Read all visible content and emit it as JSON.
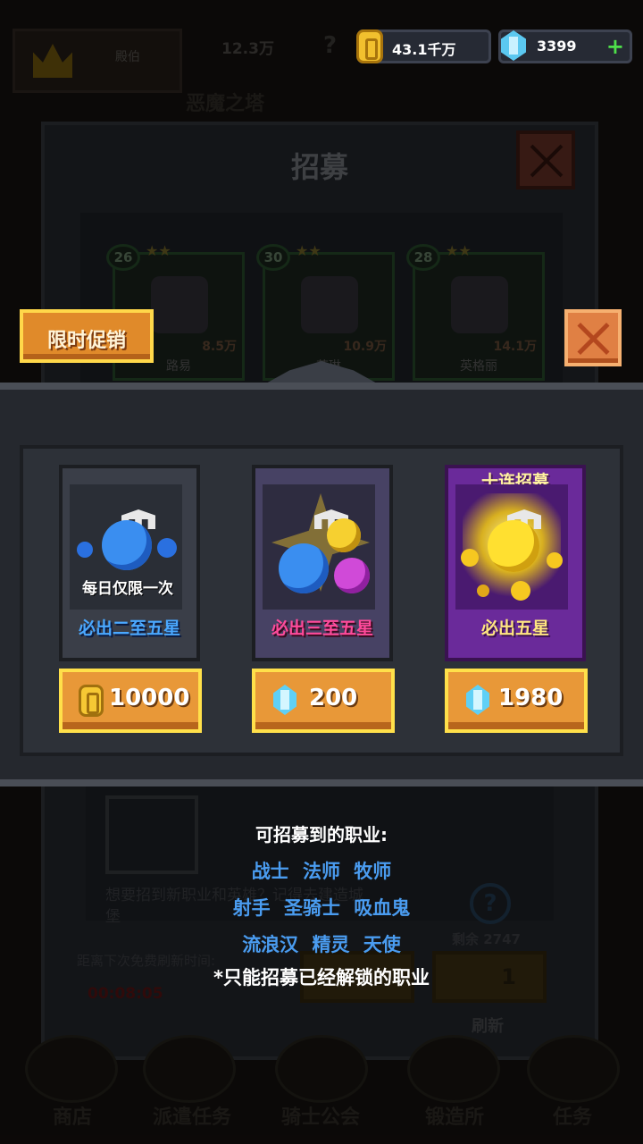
{
  "topbar": {
    "player_name": "殿伯",
    "power": "12.3万",
    "help": "?",
    "gold": "43.1千万",
    "gems": "3399",
    "add": "+"
  },
  "background": {
    "tower_title": "恶魔之塔",
    "dialog_title": "招募",
    "heroes": [
      {
        "level": "26",
        "stars": "★★",
        "power": "8.5万",
        "name": "路易"
      },
      {
        "level": "30",
        "stars": "★★",
        "power": "10.9万",
        "name": "艾琳"
      },
      {
        "level": "28",
        "stars": "★★",
        "power": "14.1万",
        "name": "英格丽"
      }
    ],
    "hint": "想要招到新职业和英雄？记得去建造城堡",
    "remaining": "剩余 2747",
    "refresh_countdown_label": "距离下次免费刷新时间:",
    "refresh_timer": "00:08:05",
    "refresh_cost": "1",
    "refresh_label": "刷新",
    "nav": [
      "商店",
      "派遣任务",
      "骑士公会",
      "锻造所",
      "任务"
    ]
  },
  "promo": {
    "tag": "限时促销",
    "offers": [
      {
        "note": "每日仅限一次",
        "subtitle": "必出二至五星",
        "price": "10000",
        "currency": "gold"
      },
      {
        "subtitle": "必出三至五星",
        "price": "200",
        "currency": "gem"
      },
      {
        "badge": "十连招募",
        "subtitle": "必出五星",
        "price": "1980",
        "currency": "gem"
      }
    ]
  },
  "classes": {
    "title": "可招募到的职业:",
    "rows": [
      "战士 法师 牧师",
      "射手 圣骑士 吸血鬼",
      "流浪汉 精灵 天使"
    ],
    "note": "*只能招募已经解锁的职业"
  },
  "colors": {
    "accent_orange": "#e89838",
    "button_border_yellow": "#ffe04a",
    "class_blue": "#4a9cf0",
    "subtitle_blue": "#4aa8ff",
    "subtitle_pink": "#ff4a9a",
    "subtitle_gold": "#ffe680"
  }
}
